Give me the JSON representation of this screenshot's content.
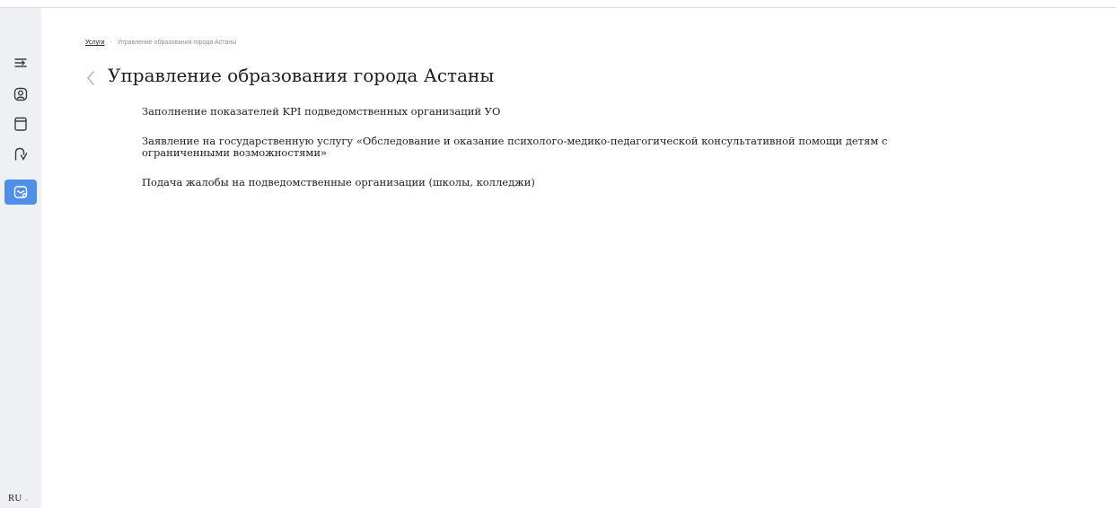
{
  "sidebar": {
    "items": [
      {
        "icon": "collapse-menu-icon"
      },
      {
        "icon": "user-profile-icon"
      },
      {
        "icon": "database-icon"
      },
      {
        "icon": "process-icon"
      },
      {
        "icon": "services-icon",
        "active": true
      }
    ],
    "language": "RU"
  },
  "breadcrumb": {
    "root": "Услуги",
    "separator": "-",
    "current": "Управление образования города Астаны"
  },
  "page": {
    "title": "Управление образования города Астаны"
  },
  "services": [
    {
      "label": "Заполнение показателей KPI подведомственных организаций УО"
    },
    {
      "label": "Заявление на государственную услугу «Обследование и оказание психолого-медико-педагогической консультативной помощи детям с ограниченными возможностями»"
    },
    {
      "label": "Подача жалобы на подведомственные организации (школы, колледжи)"
    }
  ],
  "colors": {
    "accent": "#4e8fe9",
    "sidebar_bg": "#eef0f4",
    "text": "#222222"
  }
}
